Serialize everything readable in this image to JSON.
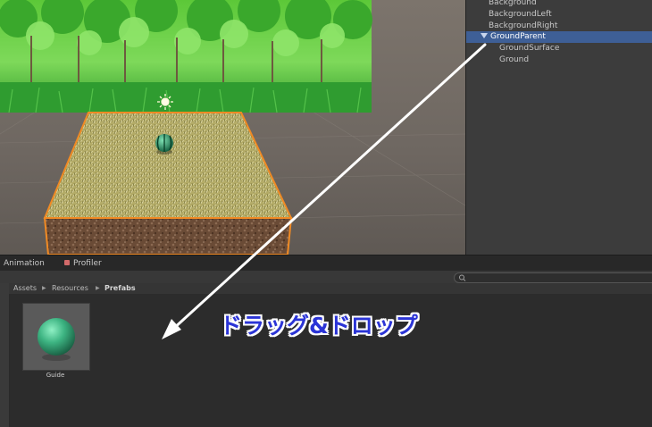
{
  "hierarchy": {
    "items": [
      {
        "label": "Background",
        "selected": false
      },
      {
        "label": "BackgroundLeft",
        "selected": false
      },
      {
        "label": "BackgroundRight",
        "selected": false
      },
      {
        "label": "GroundParent",
        "selected": true
      },
      {
        "label": "GroundSurface",
        "selected": false
      },
      {
        "label": "Ground",
        "selected": false
      }
    ]
  },
  "bottom_panel": {
    "tabs": [
      {
        "label": "Animation"
      },
      {
        "label": "Profiler"
      }
    ],
    "search_placeholder": "",
    "breadcrumb": [
      "Assets",
      "Resources",
      "Prefabs"
    ],
    "assets": [
      {
        "label": "Guide",
        "icon": "sphere-prefab-icon"
      }
    ]
  },
  "annotation": {
    "text": "ドラッグ&ドロップ",
    "color": "#2b34d6"
  },
  "colors": {
    "selection": "#3e5f96",
    "selection_outline": "#f08a24"
  }
}
